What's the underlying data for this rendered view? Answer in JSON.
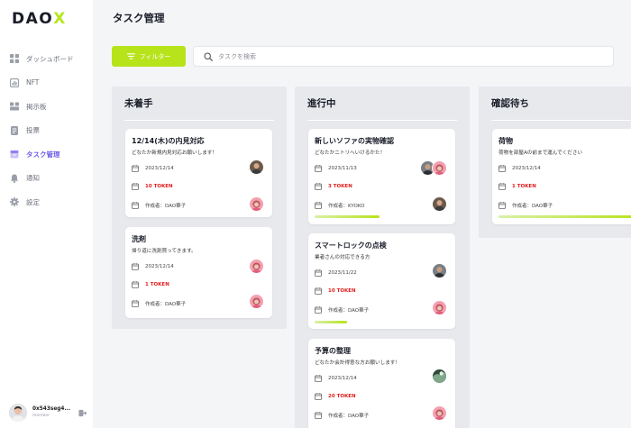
{
  "app": {
    "logo_main": "DAO",
    "logo_accent": "X",
    "page_title": "タスク管理"
  },
  "sidebar": {
    "items": [
      {
        "label": "ダッシュボード",
        "icon": "dashboard-icon",
        "active": false
      },
      {
        "label": "NFT",
        "icon": "nft-icon",
        "active": false
      },
      {
        "label": "掲示板",
        "icon": "board-icon",
        "active": false
      },
      {
        "label": "投票",
        "icon": "vote-icon",
        "active": false
      },
      {
        "label": "タスク管理",
        "icon": "task-icon",
        "active": true
      },
      {
        "label": "通知",
        "icon": "bell-icon",
        "active": false
      },
      {
        "label": "設定",
        "icon": "gear-icon",
        "active": false
      }
    ],
    "user": {
      "name": "0x543seg4...",
      "role": "member"
    }
  },
  "toolbar": {
    "filter_label": "フィルター",
    "search_placeholder": "タスクを検索"
  },
  "colors": {
    "accent": "#b7e31b",
    "active_nav": "#6d5ce8",
    "token": "#e11d1d"
  },
  "columns": [
    {
      "title": "未着手",
      "cards": [
        {
          "title": "12/14(木)の内見対応",
          "description": "どなたか新規内見対応お願いします！",
          "date": "2023/12/14",
          "token": "10 TOKEN",
          "author": "作成者：DAO華子",
          "progress": null
        },
        {
          "title": "洗剤",
          "description": "帰り道に洗剤買ってきます。",
          "date": "2023/12/14",
          "token": "1 TOKEN",
          "author": "作成者：DAO華子",
          "progress": null
        }
      ]
    },
    {
      "title": "進行中",
      "cards": [
        {
          "title": "新しいソファの実物確認",
          "description": "どなたかニトリへいけるかた！",
          "date": "2023/11/13",
          "token": "3 TOKEN",
          "author": "作成者：KYOKO",
          "progress": 0.48
        },
        {
          "title": "スマートロックの点検",
          "description": "業者さんの対応できる方",
          "date": "2023/11/22",
          "token": "10 TOKEN",
          "author": "作成者：DAO華子",
          "progress": 0.24
        },
        {
          "title": "予算の整理",
          "description": "どなたか会計得意な方お願いします！",
          "date": "2023/12/14",
          "token": "20 TOKEN",
          "author": "作成者：DAO華子",
          "progress": null
        }
      ]
    },
    {
      "title": "確認待ち",
      "cards": [
        {
          "title": "荷物",
          "description": "荷物を部屋Aの前まで運んでください",
          "date": "2023/12/14",
          "token": "1 TOKEN",
          "author": "作成者：DAO華子",
          "progress": 1.0
        }
      ]
    }
  ]
}
